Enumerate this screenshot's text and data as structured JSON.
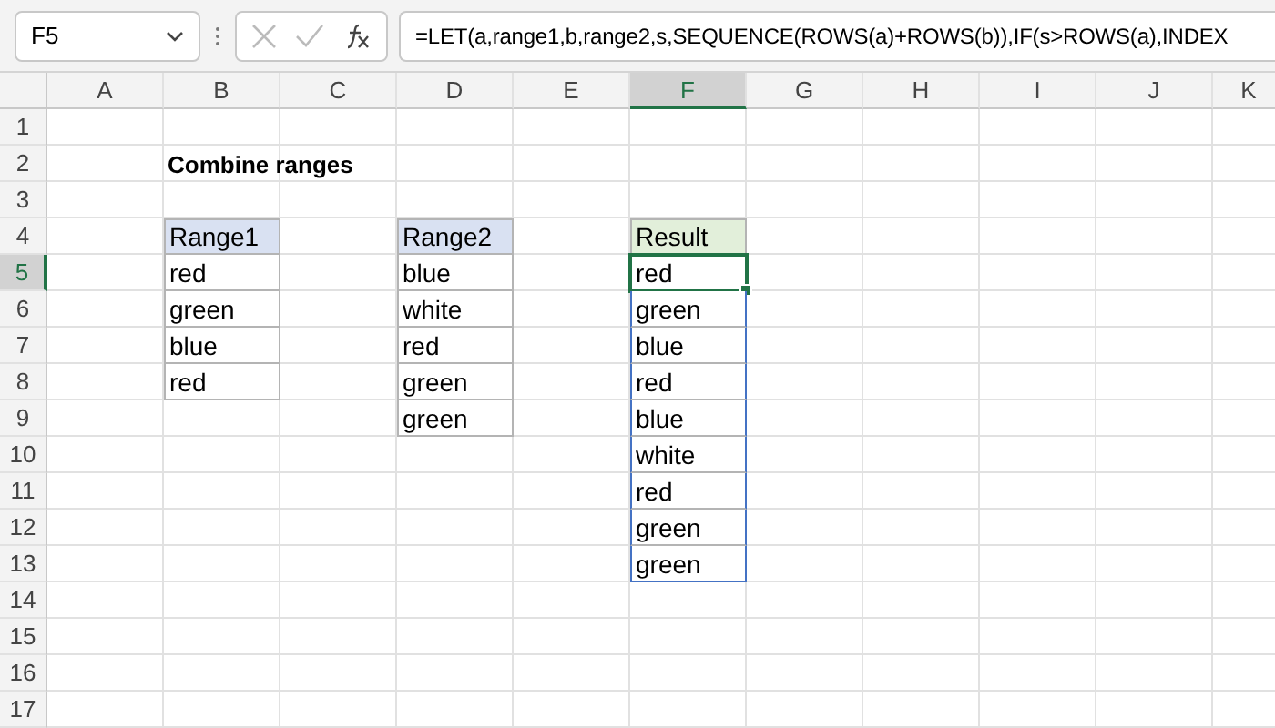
{
  "formula_bar": {
    "name_box": "F5",
    "formula": "=LET(a,range1,b,range2,s,SEQUENCE(ROWS(a)+ROWS(b)),IF(s>ROWS(a),INDEX"
  },
  "columns": [
    {
      "label": "A",
      "selected": false
    },
    {
      "label": "B",
      "selected": false
    },
    {
      "label": "C",
      "selected": false
    },
    {
      "label": "D",
      "selected": false
    },
    {
      "label": "E",
      "selected": false
    },
    {
      "label": "F",
      "selected": true
    },
    {
      "label": "G",
      "selected": false
    },
    {
      "label": "H",
      "selected": false
    },
    {
      "label": "I",
      "selected": false
    },
    {
      "label": "J",
      "selected": false
    },
    {
      "label": "K",
      "selected": false
    }
  ],
  "rows": [
    {
      "label": "1",
      "selected": false
    },
    {
      "label": "2",
      "selected": false
    },
    {
      "label": "3",
      "selected": false
    },
    {
      "label": "4",
      "selected": false
    },
    {
      "label": "5",
      "selected": true
    },
    {
      "label": "6",
      "selected": false
    },
    {
      "label": "7",
      "selected": false
    },
    {
      "label": "8",
      "selected": false
    },
    {
      "label": "9",
      "selected": false
    },
    {
      "label": "10",
      "selected": false
    },
    {
      "label": "11",
      "selected": false
    },
    {
      "label": "12",
      "selected": false
    },
    {
      "label": "13",
      "selected": false
    },
    {
      "label": "14",
      "selected": false
    },
    {
      "label": "15",
      "selected": false
    },
    {
      "label": "16",
      "selected": false
    },
    {
      "label": "17",
      "selected": false
    }
  ],
  "title": "Combine ranges",
  "tables": [
    {
      "kind": "input",
      "header": "Range1",
      "values": [
        {
          "text": "red",
          "selected": false
        },
        {
          "text": "green",
          "selected": false
        },
        {
          "text": "blue",
          "selected": false
        },
        {
          "text": "red",
          "selected": false
        }
      ]
    },
    {
      "kind": "input",
      "header": "Range2",
      "values": [
        {
          "text": "blue",
          "selected": false
        },
        {
          "text": "white",
          "selected": false
        },
        {
          "text": "red",
          "selected": false
        },
        {
          "text": "green",
          "selected": false
        },
        {
          "text": "green",
          "selected": false
        }
      ]
    },
    {
      "kind": "result",
      "header": "Result",
      "values": [
        {
          "text": "red",
          "selected": true
        },
        {
          "text": "green",
          "selected": false
        },
        {
          "text": "blue",
          "selected": false
        },
        {
          "text": "red",
          "selected": false
        },
        {
          "text": "blue",
          "selected": false
        },
        {
          "text": "white",
          "selected": false
        },
        {
          "text": "red",
          "selected": false
        },
        {
          "text": "green",
          "selected": false
        },
        {
          "text": "green",
          "selected": false
        }
      ]
    }
  ]
}
